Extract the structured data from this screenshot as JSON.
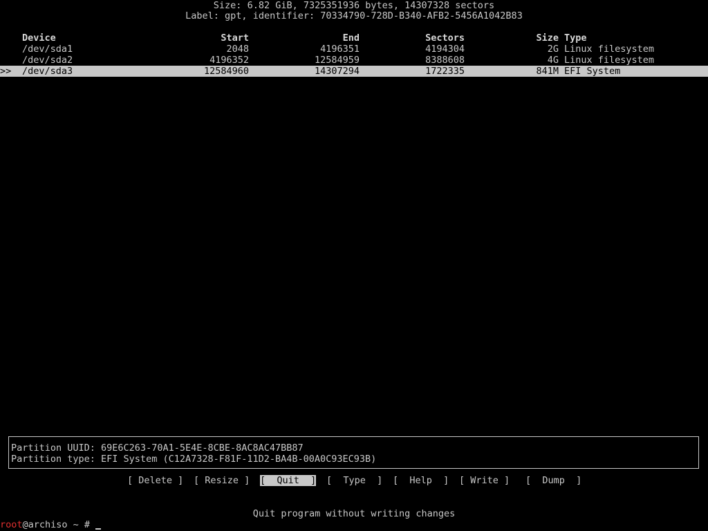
{
  "disk": {
    "size_line": "Size: 6.82 GiB, 7325351936 bytes, 14307328 sectors",
    "label_line": "Label: gpt, identifier: 70334790-728D-B340-AFB2-5456A1042B83"
  },
  "table": {
    "headers": {
      "device": "Device",
      "start": "Start",
      "end": "End",
      "sectors": "Sectors",
      "size": "Size",
      "type": "Type"
    },
    "rows": [
      {
        "marker": "",
        "device": "/dev/sda1",
        "start": "2048",
        "end": "4196351",
        "sectors": "4194304",
        "size": "2G",
        "type": "Linux filesystem"
      },
      {
        "marker": "",
        "device": "/dev/sda2",
        "start": "4196352",
        "end": "12584959",
        "sectors": "8388608",
        "size": "4G",
        "type": "Linux filesystem"
      },
      {
        "marker": ">>",
        "device": "/dev/sda3",
        "start": "12584960",
        "end": "14307294",
        "sectors": "1722335",
        "size": "841M",
        "type": "EFI System"
      }
    ]
  },
  "info": {
    "uuid_line": "Partition UUID: 69E6C263-70A1-5E4E-8CBE-8AC8AC47BB87",
    "type_line": "Partition type: EFI System (C12A7328-F81F-11D2-BA4B-00A0C93EC93B)"
  },
  "menu": {
    "delete": "[ Delete ]",
    "resize": "[ Resize ]",
    "quit": "[  Quit  ]",
    "type": "[  Type  ]",
    "help": "[  Help  ]",
    "write": "[ Write ]",
    "dump": "[  Dump  ]"
  },
  "status": "Quit program without writing changes",
  "prompt": {
    "user": "root",
    "rest": "@archiso ~ # "
  }
}
